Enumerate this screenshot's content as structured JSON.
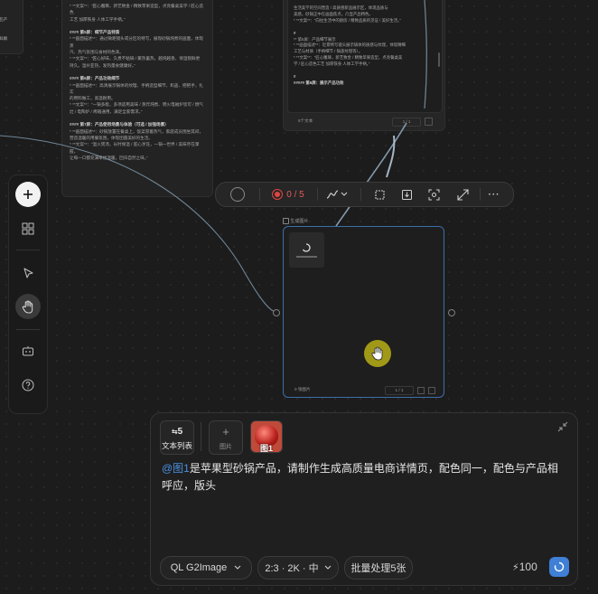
{
  "cards": {
    "left_text_card": {
      "lines": [
        "* **文案**：“匠心雕琢，新艺致金 / 精致苹果造型，点亮餐桌美学 / 匠心造色",
        "工艺 加厚铁身 人体工学手柄。”",
        "",
        "#### 第5屏：细节产品特质",
        "* **画面描述**：通过微距镜头或分区的特写，展现砂锅炖煮的画面，体现蒸",
        "汽、热气氛围与食材的色泽。",
        "* **文案**：“匠心好味，久煮不粘锅 / 聚热蓄热，越炖越香，保温锁鲜更",
        "持久。温补亚热，发热量食健康好。”",
        "",
        "#### 第6屏：产品功效细节",
        "* **画面描述**：高清展示锅体的纹理、手柄造型细节，和盖、把把手，扎实",
        "的用料做工，高温耐用。",
        "* **文案**：“一锅多能，多项适用美味 / 蒸炸炖煮、明火电磁炉皆可 / 燃气",
        "灶 / 电陶炉 / 烤箱通用，满足全家需求。”",
        "",
        "#### 第7屏：产品使用场景与体验（可选 / 加强场景）",
        "* **画面描述**：砂锅放置在餐桌上，饭菜冒着热气，家庭成员围坐其间，",
        "营造温暖的用餐氛围，体现团圆美好的生活。",
        "* **文案**：“温火煲汤，长时保温 / 匠心烹饪，一锅一世界 / 美味尽在掌握，",
        "让每一口都充满幸福温暖，回归自然之味。”"
      ]
    },
    "right_text_card": {
      "lines": [
        "生活美学的空间营造 / 高质感新品展示区，体现品质与",
        "美感。砂锅正中在画面焦点，凸显产品特色。",
        "* **文案**：“向往生活中的厨房 / 精致品质的见证 / 美好生活。”",
        "",
        "#",
        "** 第5屏：产品细节展示",
        "* **画面描述**：近景特写镜头展示锅体的质感与纹理，体现精细",
        "工艺与材质（手柄细节 / 锅盖纹理等）。",
        "* **文案**：“匠心雕琢，新艺致金 / 精致苹果造型，点亮餐桌美",
        "学 / 匠心造色工艺 加厚铁身 人体工学手柄。”",
        "",
        "#",
        "##### 第6屏：展示产品功效"
      ],
      "footer_left": "5个文本",
      "footer_right": "1 / 1"
    },
    "left_top_fragment": [
      "品产",
      "鲜嫩",
      "经"
    ]
  },
  "toolbar": {
    "counter": "0 / 5"
  },
  "node": {
    "title": "生成图片",
    "footer_left": "0 张图片",
    "footer_right": "1 / 1"
  },
  "panel": {
    "text_list_count": "5",
    "text_list_label": "文本列表",
    "add_image_label": "图片",
    "image_ref_label": "图1",
    "prompt_mention": "@图1",
    "prompt_body": "是苹果型砂锅产品，请制作生成高质量电商详情页，配色同一，配色与产品相呼应，版头",
    "model_label": "QL G2Image",
    "ratio_label": "2:3 · 2K · 中",
    "batch_label": "批量处理5张",
    "credits": "100"
  },
  "colors": {
    "accent_blue": "#4a8fe0",
    "record_red": "#e04545",
    "cursor_yellow": "#a8a018"
  }
}
